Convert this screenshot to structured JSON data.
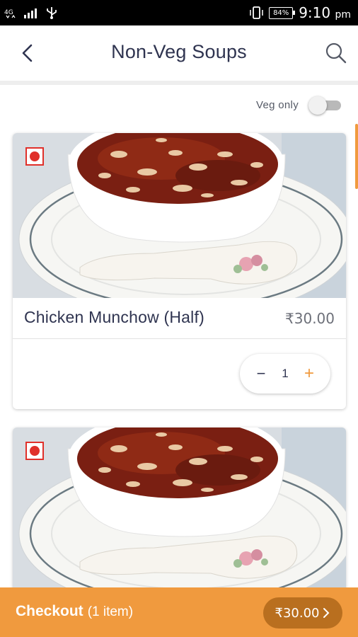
{
  "status_bar": {
    "battery": "84%",
    "time": "9:10",
    "ampm": "pm",
    "icons": [
      "data-4g-icon",
      "signal-icon",
      "usb-icon",
      "vibrate-icon",
      "battery-icon"
    ]
  },
  "header": {
    "title": "Non-Veg Soups",
    "icons": [
      "back-arrow-icon",
      "search-icon"
    ]
  },
  "filter": {
    "veg_only_label": "Veg only",
    "veg_only_on": false
  },
  "items": [
    {
      "name": "Chicken Munchow (Half)",
      "price": "₹30.00",
      "qty": "1",
      "type": "non-veg"
    },
    {
      "name": "",
      "price": "",
      "type": "non-veg"
    }
  ],
  "stepper": {
    "minus": "−",
    "plus": "+"
  },
  "checkout": {
    "label": "Checkout",
    "count": "(1 item)",
    "total": "₹30.00"
  },
  "colors": {
    "accent": "#f09a3e",
    "accent_dark": "#b96f1f",
    "title": "#2f3450",
    "nonveg": "#e0302a"
  }
}
